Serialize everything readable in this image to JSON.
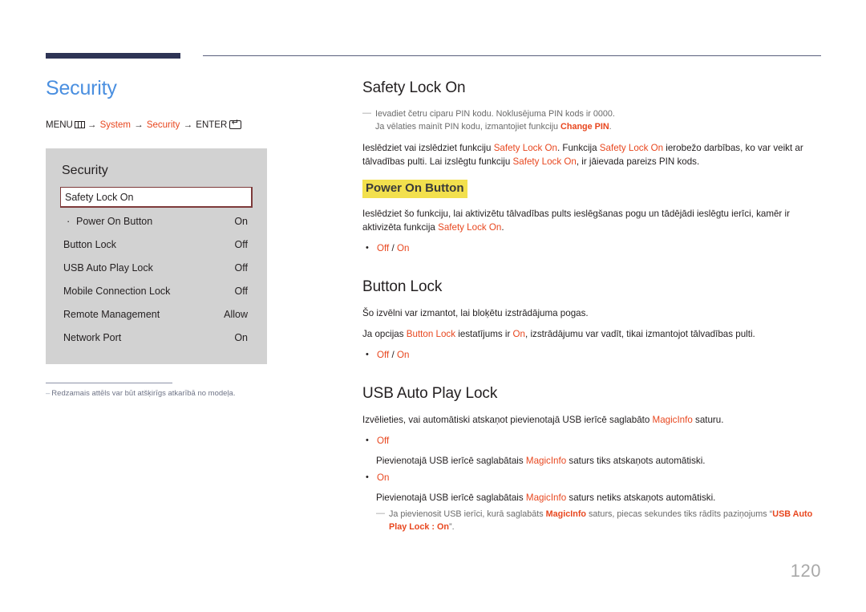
{
  "header": {
    "rule_color_thick": "#2e3455",
    "rule_color_thin": "#5a5f7d"
  },
  "left": {
    "page_title": "Security",
    "breadcrumb": {
      "menu_label": "MENU",
      "menu_icon": "menu-grid-icon",
      "arrow": "→",
      "item1": "System",
      "item2": "Security",
      "enter_label": "ENTER",
      "enter_icon": "enter-return-icon"
    },
    "osd": {
      "title": "Security",
      "rows": [
        {
          "label": "Safety Lock On",
          "value": "",
          "selected": true,
          "sub": false
        },
        {
          "label": "Power On Button",
          "value": "On",
          "selected": false,
          "sub": true
        },
        {
          "label": "Button Lock",
          "value": "Off",
          "selected": false,
          "sub": false
        },
        {
          "label": "USB Auto Play Lock",
          "value": "Off",
          "selected": false,
          "sub": false
        },
        {
          "label": "Mobile Connection Lock",
          "value": "Off",
          "selected": false,
          "sub": false
        },
        {
          "label": "Remote Management",
          "value": "Allow",
          "selected": false,
          "sub": false
        },
        {
          "label": "Network Port",
          "value": "On",
          "selected": false,
          "sub": false
        }
      ]
    },
    "figure_note": {
      "dash": "–",
      "text": "Redzamais attēls var būt atšķirīgs atkarībā no modeļa."
    }
  },
  "right": {
    "safety_lock": {
      "heading": "Safety Lock On",
      "note_line1": "Ievadiet četru ciparu PIN kodu. Noklusējuma PIN kods ir 0000.",
      "note_line2_pre": "Ja vēlaties mainīt PIN kodu, izmantojiet funkciju ",
      "note_line2_accent": "Change PIN",
      "note_line2_post": ".",
      "para_p1": "Ieslēdziet vai izslēdziet funkciju ",
      "para_a1": "Safety Lock On",
      "para_p2": ". Funkcija ",
      "para_a2": "Safety Lock On",
      "para_p3": " ierobežo darbības, ko var veikt ar tālvadības pulti. Lai izslēgtu funkciju ",
      "para_a3": "Safety Lock On",
      "para_p4": ", ir jāievada pareizs PIN kods."
    },
    "power_on_button": {
      "heading": "Power On Button",
      "highlight_color": "#f2e04d",
      "para_p1": "Ieslēdziet šo funkciju, lai aktivizētu tālvadības pults ieslēgšanas pogu un tādējādi ieslēgtu ierīci, kamēr ir aktivizēta funkcija ",
      "para_a1": "Safety Lock On",
      "para_p2": ".",
      "bullet_off": "Off",
      "bullet_sep": " / ",
      "bullet_on": "On"
    },
    "button_lock": {
      "heading": "Button Lock",
      "para1": "Šo izvēlni var izmantot, lai bloķētu izstrādājuma pogas.",
      "para2_p1": "Ja opcijas ",
      "para2_a1": "Button Lock",
      "para2_p2": " iestatījums ir ",
      "para2_a2": "On",
      "para2_p3": ", izstrādājumu var vadīt, tikai izmantojot tālvadības pulti.",
      "bullet_off": "Off",
      "bullet_sep": " / ",
      "bullet_on": "On"
    },
    "usb_auto_play_lock": {
      "heading": "USB Auto Play Lock",
      "para_p1": "Izvēlieties, vai automātiski atskaņot pievienotajā USB ierīcē saglabāto ",
      "para_a1": "MagicInfo",
      "para_p2": " saturu.",
      "opt_off_label": "Off",
      "opt_off_desc_p1": "Pievienotajā USB ierīcē saglabātais ",
      "opt_off_desc_a1": "MagicInfo",
      "opt_off_desc_p2": " saturs tiks atskaņots automātiski.",
      "opt_on_label": "On",
      "opt_on_desc_p1": "Pievienotajā USB ierīcē saglabātais ",
      "opt_on_desc_a1": "MagicInfo",
      "opt_on_desc_p2": " saturs netiks atskaņots automātiski.",
      "note_p1": "Ja pievienosit USB ierīci, kurā saglabāts ",
      "note_a1": "MagicInfo",
      "note_p2": " saturs, piecas sekundes tiks rādīts paziņojums “",
      "note_a2": "USB Auto Play Lock : On",
      "note_p3": "”."
    }
  },
  "footer": {
    "page_number": "120"
  }
}
